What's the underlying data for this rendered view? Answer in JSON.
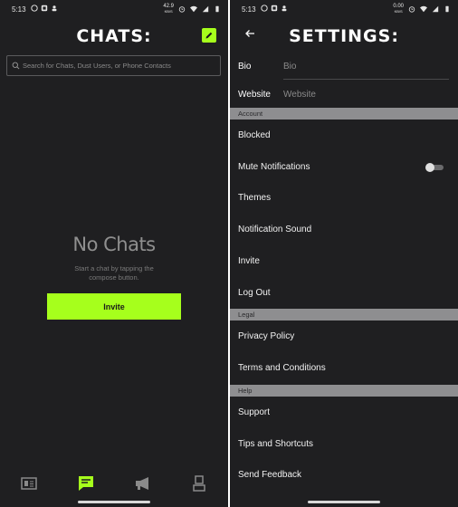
{
  "colors": {
    "accent": "#a6ff1c",
    "background": "#1f1f21",
    "section_header": "#8e8e90"
  },
  "left": {
    "status": {
      "time": "5:13",
      "net_speed_top": "42.9",
      "net_speed_bottom": "KB/S"
    },
    "title": "CHATS:",
    "search": {
      "placeholder": "Search for Chats, Dust Users, or Phone Contacts"
    },
    "empty_state": {
      "title": "No Chats",
      "subtitle": "Start a chat by tapping the compose button."
    },
    "invite_label": "Invite",
    "nav": [
      "news-icon",
      "chats-icon",
      "megaphone-icon",
      "profile-icon"
    ],
    "active_nav": "chats-icon"
  },
  "right": {
    "status": {
      "time": "5:13",
      "net_speed_top": "0.00",
      "net_speed_bottom": "KB/S"
    },
    "title": "SETTINGS:",
    "bio": {
      "label": "Bio",
      "placeholder": "Bio"
    },
    "website": {
      "label": "Website",
      "placeholder": "Website"
    },
    "sections": {
      "account": "Account",
      "legal": "Legal",
      "help": "Help"
    },
    "account_items": [
      "Blocked",
      "Mute Notifications",
      "Themes",
      "Notification Sound",
      "Invite",
      "Log Out"
    ],
    "legal_items": [
      "Privacy Policy",
      "Terms and Conditions"
    ],
    "help_items": [
      "Support",
      "Tips and Shortcuts",
      "Send Feedback"
    ],
    "mute_notifications_on": false
  }
}
